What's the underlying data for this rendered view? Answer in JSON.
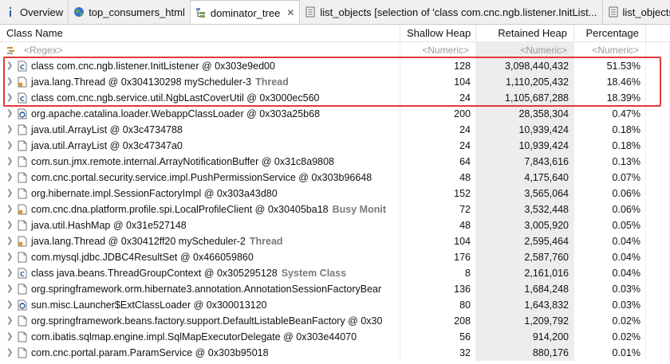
{
  "tabs": [
    {
      "label": "Overview",
      "icon": "info-icon",
      "active": false
    },
    {
      "label": "top_consumers_html",
      "icon": "globe-icon",
      "active": false
    },
    {
      "label": "dominator_tree",
      "icon": "tree-icon",
      "active": true
    },
    {
      "label": "list_objects [selection of 'class com.cnc.ngb.listener.InitList...",
      "icon": "table-icon",
      "active": false
    },
    {
      "label": "list_objects [s",
      "icon": "table-icon",
      "active": false
    }
  ],
  "columns": {
    "class_name": "Class Name",
    "shallow_heap": "Shallow Heap",
    "retained_heap": "Retained Heap",
    "percentage": "Percentage"
  },
  "filters": {
    "class_name": "<Regex>",
    "shallow_heap": "<Numeric>",
    "retained_heap": "<Numeric>",
    "percentage": "<Numeric>"
  },
  "rows": [
    {
      "icon": "class-icon",
      "name": "class com.cnc.ngb.listener.InitListener @ 0x303e9ed00",
      "extra": "",
      "shallow": "128",
      "retained": "3,098,440,432",
      "percentage": "51.53%"
    },
    {
      "icon": "thread-icon",
      "name": "java.lang.Thread @ 0x304130298  myScheduler-3",
      "extra": "Thread",
      "shallow": "104",
      "retained": "1,110,205,432",
      "percentage": "18.46%"
    },
    {
      "icon": "class-icon",
      "name": "class com.cnc.ngb.service.util.NgbLastCoverUtil @ 0x3000ec560",
      "extra": "",
      "shallow": "24",
      "retained": "1,105,687,288",
      "percentage": "18.39%"
    },
    {
      "icon": "classloader-icon",
      "name": "org.apache.catalina.loader.WebappClassLoader @ 0x303a25b68",
      "extra": "",
      "shallow": "200",
      "retained": "28,358,304",
      "percentage": "0.47%"
    },
    {
      "icon": "object-icon",
      "name": "java.util.ArrayList @ 0x3c4734788",
      "extra": "",
      "shallow": "24",
      "retained": "10,939,424",
      "percentage": "0.18%"
    },
    {
      "icon": "object-icon",
      "name": "java.util.ArrayList @ 0x3c47347a0",
      "extra": "",
      "shallow": "24",
      "retained": "10,939,424",
      "percentage": "0.18%"
    },
    {
      "icon": "object-icon",
      "name": "com.sun.jmx.remote.internal.ArrayNotificationBuffer @ 0x31c8a9808",
      "extra": "",
      "shallow": "64",
      "retained": "7,843,616",
      "percentage": "0.13%"
    },
    {
      "icon": "object-icon",
      "name": "com.cnc.portal.security.service.impl.PushPermissionService @ 0x303b96648",
      "extra": "",
      "shallow": "48",
      "retained": "4,175,640",
      "percentage": "0.07%"
    },
    {
      "icon": "object-icon",
      "name": "org.hibernate.impl.SessionFactoryImpl @ 0x303a43d80",
      "extra": "",
      "shallow": "152",
      "retained": "3,565,064",
      "percentage": "0.06%"
    },
    {
      "icon": "thread-icon",
      "name": "com.cnc.dna.platform.profile.spi.LocalProfileClient @ 0x30405ba18",
      "extra": "Busy Monit",
      "shallow": "72",
      "retained": "3,532,448",
      "percentage": "0.06%"
    },
    {
      "icon": "object-icon",
      "name": "java.util.HashMap @ 0x31e527148",
      "extra": "",
      "shallow": "48",
      "retained": "3,005,920",
      "percentage": "0.05%"
    },
    {
      "icon": "thread-icon",
      "name": "java.lang.Thread @ 0x30412ff20  myScheduler-2",
      "extra": "Thread",
      "shallow": "104",
      "retained": "2,595,464",
      "percentage": "0.04%"
    },
    {
      "icon": "object-icon",
      "name": "com.mysql.jdbc.JDBC4ResultSet @ 0x466059860",
      "extra": "",
      "shallow": "176",
      "retained": "2,587,760",
      "percentage": "0.04%"
    },
    {
      "icon": "class-icon",
      "name": "class java.beans.ThreadGroupContext @ 0x305295128",
      "extra": "System Class",
      "shallow": "8",
      "retained": "2,161,016",
      "percentage": "0.04%"
    },
    {
      "icon": "object-icon",
      "name": "org.springframework.orm.hibernate3.annotation.AnnotationSessionFactoryBear",
      "extra": "",
      "shallow": "136",
      "retained": "1,684,248",
      "percentage": "0.03%"
    },
    {
      "icon": "classloader-icon",
      "name": "sun.misc.Launcher$ExtClassLoader @ 0x300013120",
      "extra": "",
      "shallow": "80",
      "retained": "1,643,832",
      "percentage": "0.03%"
    },
    {
      "icon": "object-icon",
      "name": "org.springframework.beans.factory.support.DefaultListableBeanFactory @ 0x30",
      "extra": "",
      "shallow": "208",
      "retained": "1,209,792",
      "percentage": "0.02%"
    },
    {
      "icon": "object-icon",
      "name": "com.ibatis.sqlmap.engine.impl.SqlMapExecutorDelegate @ 0x303e44070",
      "extra": "",
      "shallow": "56",
      "retained": "914,200",
      "percentage": "0.02%"
    },
    {
      "icon": "object-icon",
      "name": "com.cnc.portal.param.ParamService @ 0x303b95018",
      "extra": "",
      "shallow": "32",
      "retained": "880,176",
      "percentage": "0.01%"
    }
  ],
  "colors": {
    "highlight": "#e03a3a",
    "extra_text": "#7a7a7a",
    "filter_text": "#9a9a9a"
  }
}
